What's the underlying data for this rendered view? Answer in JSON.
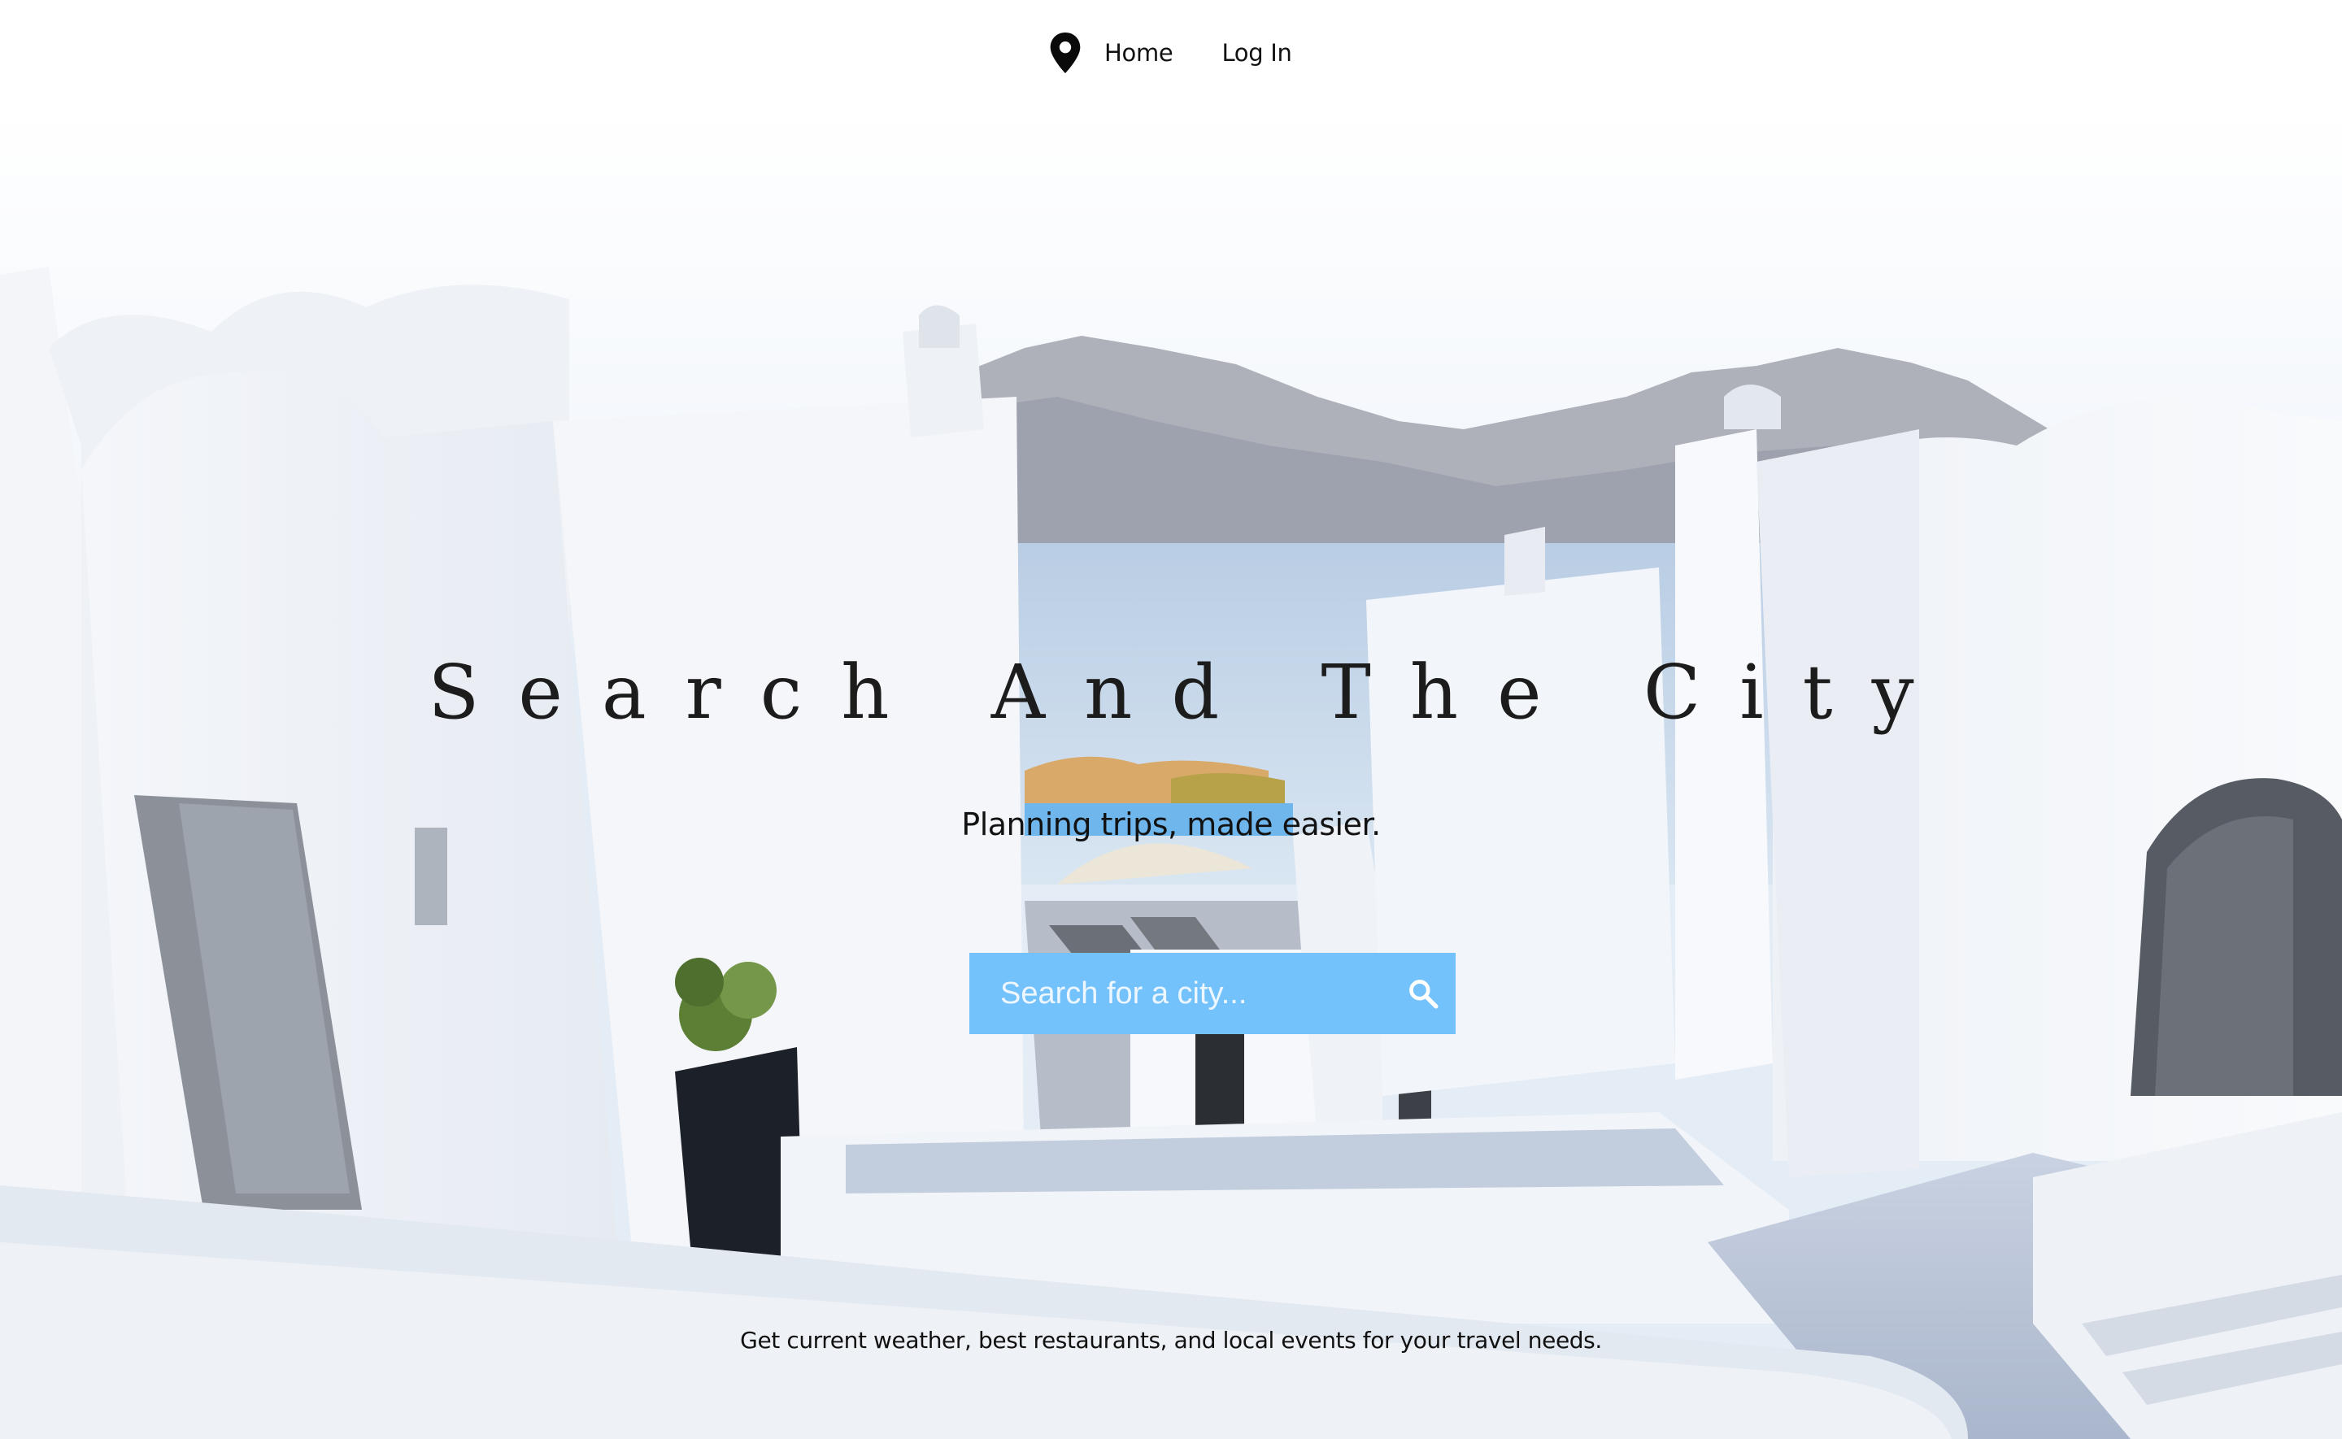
{
  "nav": {
    "items": [
      {
        "label": "Home"
      },
      {
        "label": "Log In"
      }
    ]
  },
  "hero": {
    "title": "Search And The City",
    "tagline": "Planning trips, made easier.",
    "search": {
      "placeholder": "Search for a city...",
      "value": ""
    },
    "footer_note": "Get current weather, best restaurants, and local events for your travel needs."
  },
  "colors": {
    "search_box": "#74c2fb",
    "nav_background": "#ffffff",
    "text": "#111111"
  },
  "icons": {
    "nav_logo": "map-pin-icon",
    "search": "search-icon"
  }
}
